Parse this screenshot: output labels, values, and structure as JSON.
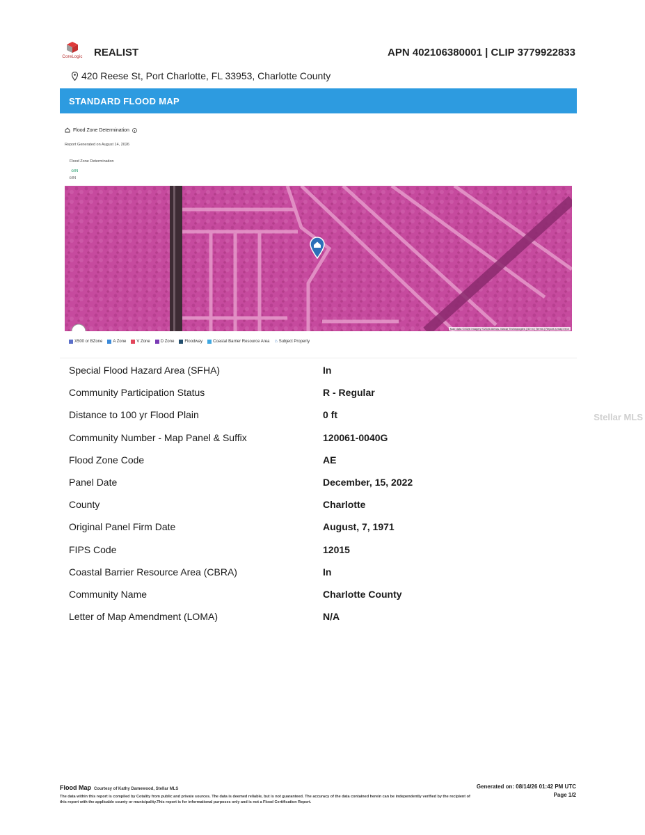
{
  "header": {
    "logo_text": "CoreLogic",
    "brand": "REALIST",
    "apn_clip": "APN 402106380001 | CLIP 3779922833",
    "address": "420 Reese St, Port Charlotte, FL 33953, Charlotte County"
  },
  "section_title": "STANDARD FLOOD MAP",
  "fzd": {
    "heading": "Flood Zone Determination",
    "report_generated": "Report Generated on August 14, 2026",
    "subheading": "Flood Zone Determination",
    "status_in_1": "IN",
    "status_in_2": "IN"
  },
  "map": {
    "attribution": "Map data ©2026 Imagery ©2026 Airbus, Maxar Technologies | 50 m | Terms | Report a map error",
    "zone_color": "#c94aa3"
  },
  "legend": [
    {
      "label": "X500 or BZone",
      "color": "#5b6fc9"
    },
    {
      "label": "A Zone",
      "color": "#3b8ad9"
    },
    {
      "label": "V Zone",
      "color": "#e2455a"
    },
    {
      "label": "D Zone",
      "color": "#7a3bb5"
    },
    {
      "label": "Floodway",
      "color": "#234f6e"
    },
    {
      "label": "Coastal Barrier Resource Area",
      "color": "#3fa7e0"
    },
    {
      "label": "Subject Property",
      "color": "#2c6fb8"
    }
  ],
  "rows": [
    {
      "label": "Special Flood Hazard Area (SFHA)",
      "value": "In"
    },
    {
      "label": "Community Participation Status",
      "value": "R - Regular"
    },
    {
      "label": "Distance to 100 yr Flood Plain",
      "value": "0 ft"
    },
    {
      "label": "Community Number - Map Panel & Suffix",
      "value": "120061-0040G"
    },
    {
      "label": "Flood Zone Code",
      "value": "AE"
    },
    {
      "label": "Panel Date",
      "value": "December, 15, 2022"
    },
    {
      "label": "County",
      "value": "Charlotte"
    },
    {
      "label": "Original Panel Firm Date",
      "value": "August, 7, 1971"
    },
    {
      "label": "FIPS Code",
      "value": "12015"
    },
    {
      "label": "Coastal Barrier Resource Area (CBRA)",
      "value": "In"
    },
    {
      "label": "Community Name",
      "value": "Charlotte County"
    },
    {
      "label": "Letter of Map Amendment (LOMA)",
      "value": "N/A"
    }
  ],
  "watermark": "Stellar MLS",
  "footer": {
    "title": "Flood Map",
    "courtesy": "Courtesy of Kathy Damewood, Stellar MLS",
    "disclaimer": "The data within this report is compiled by Cotality from public and private sources. The data is deemed reliable, but is not guaranteed. The accuracy of the data contained herein can be independently verified by the recipient of this report with the applicable county or municipality.This report is for informational purposes only and is not a Flood Certification Report.",
    "generated_on": "Generated on: 08/14/26 01:42 PM UTC",
    "page": "Page 1/2"
  }
}
